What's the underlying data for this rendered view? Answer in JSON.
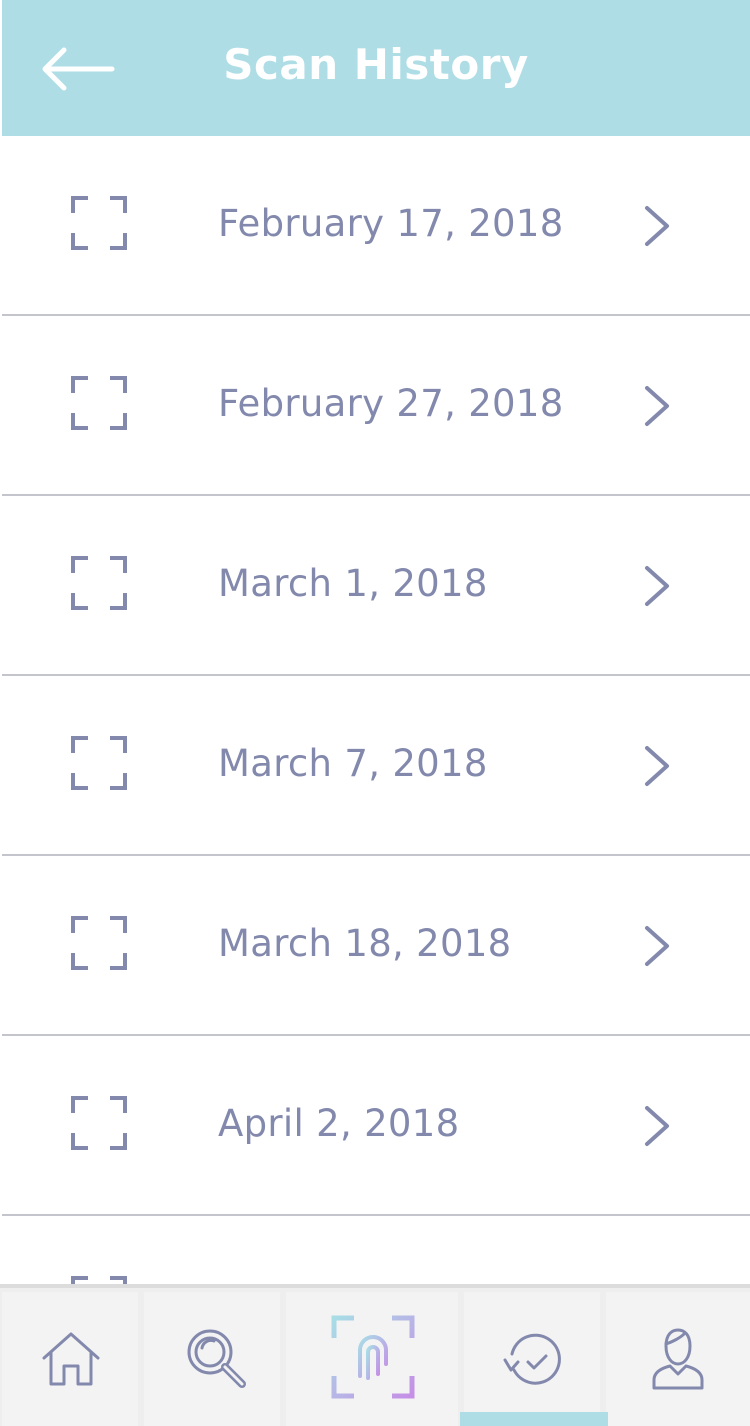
{
  "header": {
    "title": "Scan History",
    "background": "#aedde6"
  },
  "scans": [
    {
      "date": "February 17, 2018"
    },
    {
      "date": "February 27, 2018"
    },
    {
      "date": "March 1, 2018"
    },
    {
      "date": "March 7, 2018"
    },
    {
      "date": "March 18, 2018"
    },
    {
      "date": "April 2, 2018"
    },
    {
      "date": ""
    }
  ],
  "colors": {
    "text": "#8389ad",
    "divider": "#c4c4cc",
    "active_tab_indicator": "#aedde6"
  },
  "tabbar": {
    "tabs": [
      {
        "icon": "home-icon"
      },
      {
        "icon": "search-magnifier-icon"
      },
      {
        "icon": "fingerprint-scan-icon"
      },
      {
        "icon": "history-clock-icon",
        "active": true
      },
      {
        "icon": "user-profile-icon"
      }
    ]
  }
}
